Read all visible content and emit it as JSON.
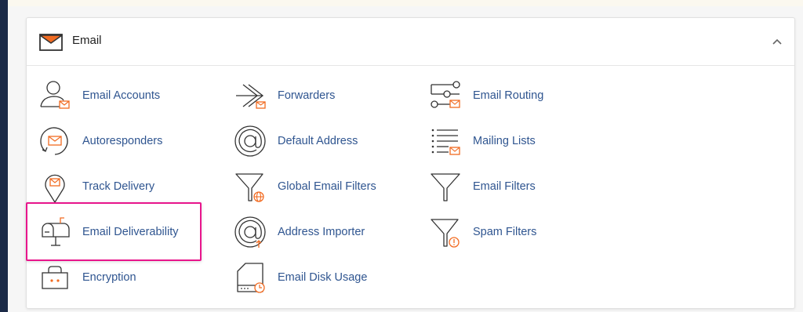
{
  "section": {
    "title": "Email",
    "header_icon": "envelope-icon",
    "collapse_icon": "chevron-up-icon"
  },
  "colors": {
    "link": "#2f5590",
    "accent": "#f26b21",
    "icon_stroke": "#333333",
    "highlight": "#e8158c"
  },
  "columns": [
    {
      "items": [
        {
          "label": "Email Accounts",
          "icon": "email-accounts-icon"
        },
        {
          "label": "Autoresponders",
          "icon": "autoresponders-icon"
        },
        {
          "label": "Track Delivery",
          "icon": "track-delivery-icon"
        },
        {
          "label": "Email Deliverability",
          "icon": "email-deliverability-icon"
        },
        {
          "label": "Encryption",
          "icon": "encryption-icon"
        }
      ]
    },
    {
      "items": [
        {
          "label": "Forwarders",
          "icon": "forwarders-icon"
        },
        {
          "label": "Default Address",
          "icon": "default-address-icon"
        },
        {
          "label": "Global Email Filters",
          "icon": "global-email-filters-icon"
        },
        {
          "label": "Address Importer",
          "icon": "address-importer-icon"
        },
        {
          "label": "Email Disk Usage",
          "icon": "email-disk-usage-icon"
        }
      ]
    },
    {
      "items": [
        {
          "label": "Email Routing",
          "icon": "email-routing-icon"
        },
        {
          "label": "Mailing Lists",
          "icon": "mailing-lists-icon"
        },
        {
          "label": "Email Filters",
          "icon": "email-filters-icon"
        },
        {
          "label": "Spam Filters",
          "icon": "spam-filters-icon"
        }
      ]
    }
  ]
}
